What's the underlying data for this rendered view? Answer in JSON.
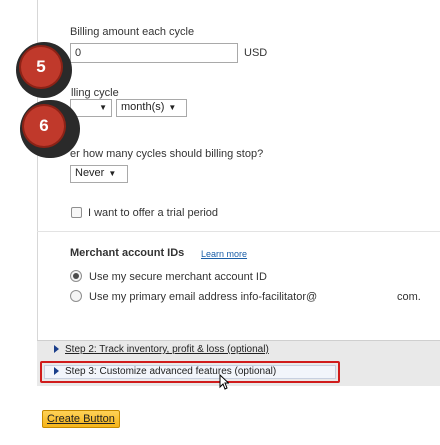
{
  "billing": {
    "amount_label": "Billing amount each cycle",
    "amount_value": "0",
    "currency": "USD",
    "cycle_label_partial": "lling cycle",
    "cycle_unit": "month(s)",
    "stop_label_partial": "er how many cycles should billing stop?",
    "stop_value": "Never",
    "trial_label": "I want to offer a trial period"
  },
  "merchant": {
    "title": "Merchant account IDs",
    "learn_more": "Learn more",
    "option_secure": "Use my secure merchant account ID",
    "option_email": "Use my primary email address info-facilitator@",
    "option_email_suffix": "com."
  },
  "steps": {
    "step2": "Step 2: Track inventory, profit & loss (optional)",
    "step3": "Step 3: Customize advanced features (optional)"
  },
  "create_button": "Create Button",
  "badges": {
    "five": "5",
    "six": "6"
  },
  "colors": {
    "badge": "#c0392b",
    "highlight": "#d01c1c",
    "button": "#f5b419"
  }
}
